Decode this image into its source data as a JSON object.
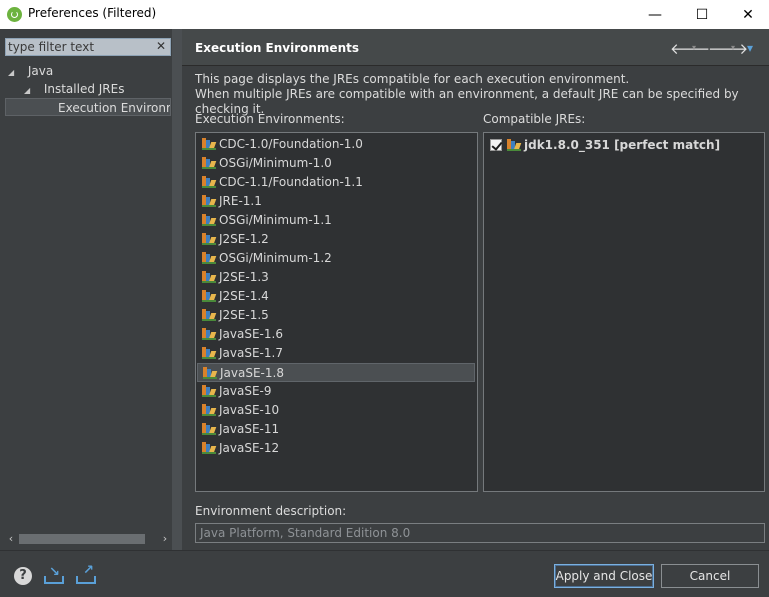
{
  "window": {
    "title": "Preferences (Filtered)",
    "minimize": "—",
    "maximize": "☐",
    "close": "✕"
  },
  "sidebar": {
    "filter_placeholder": "type filter text",
    "filter_clear": "✕",
    "tree": [
      {
        "label": "Java",
        "expanded": true,
        "arrow": "◢"
      },
      {
        "label": "Installed JREs",
        "expanded": true,
        "arrow": "◢"
      },
      {
        "label": "Execution Environments",
        "selected": true
      }
    ]
  },
  "page": {
    "title": "Execution Environments",
    "back_icon": "🡐",
    "forward_icon": "🡒",
    "menu_icon": "▾",
    "dropdown_icon": "▾",
    "description_line1": "This page displays the JREs compatible for each execution environment.",
    "description_line2": "When multiple JREs are compatible with an environment, a default JRE can be specified by checking it."
  },
  "environments": {
    "label": "Execution Environments:",
    "items": [
      "CDC-1.0/Foundation-1.0",
      "OSGi/Minimum-1.0",
      "CDC-1.1/Foundation-1.1",
      "JRE-1.1",
      "OSGi/Minimum-1.1",
      "J2SE-1.2",
      "OSGi/Minimum-1.2",
      "J2SE-1.3",
      "J2SE-1.4",
      "J2SE-1.5",
      "JavaSE-1.6",
      "JavaSE-1.7",
      "JavaSE-1.8",
      "JavaSE-9",
      "JavaSE-10",
      "JavaSE-11",
      "JavaSE-12"
    ],
    "selected": "JavaSE-1.8"
  },
  "compatible": {
    "label": "Compatible JREs:",
    "items": [
      {
        "label": "jdk1.8.0_351 [perfect match]",
        "checked": true
      }
    ]
  },
  "environment_description": {
    "label": "Environment description:",
    "value": "Java Platform, Standard Edition 8.0"
  },
  "footer": {
    "help": "?",
    "apply_close": "Apply and Close",
    "cancel": "Cancel"
  },
  "colors": {
    "accent": "#7ab0e0",
    "background": "#3c3f41",
    "list_background": "#2f3133",
    "io_icon": "#5aa0d8"
  }
}
